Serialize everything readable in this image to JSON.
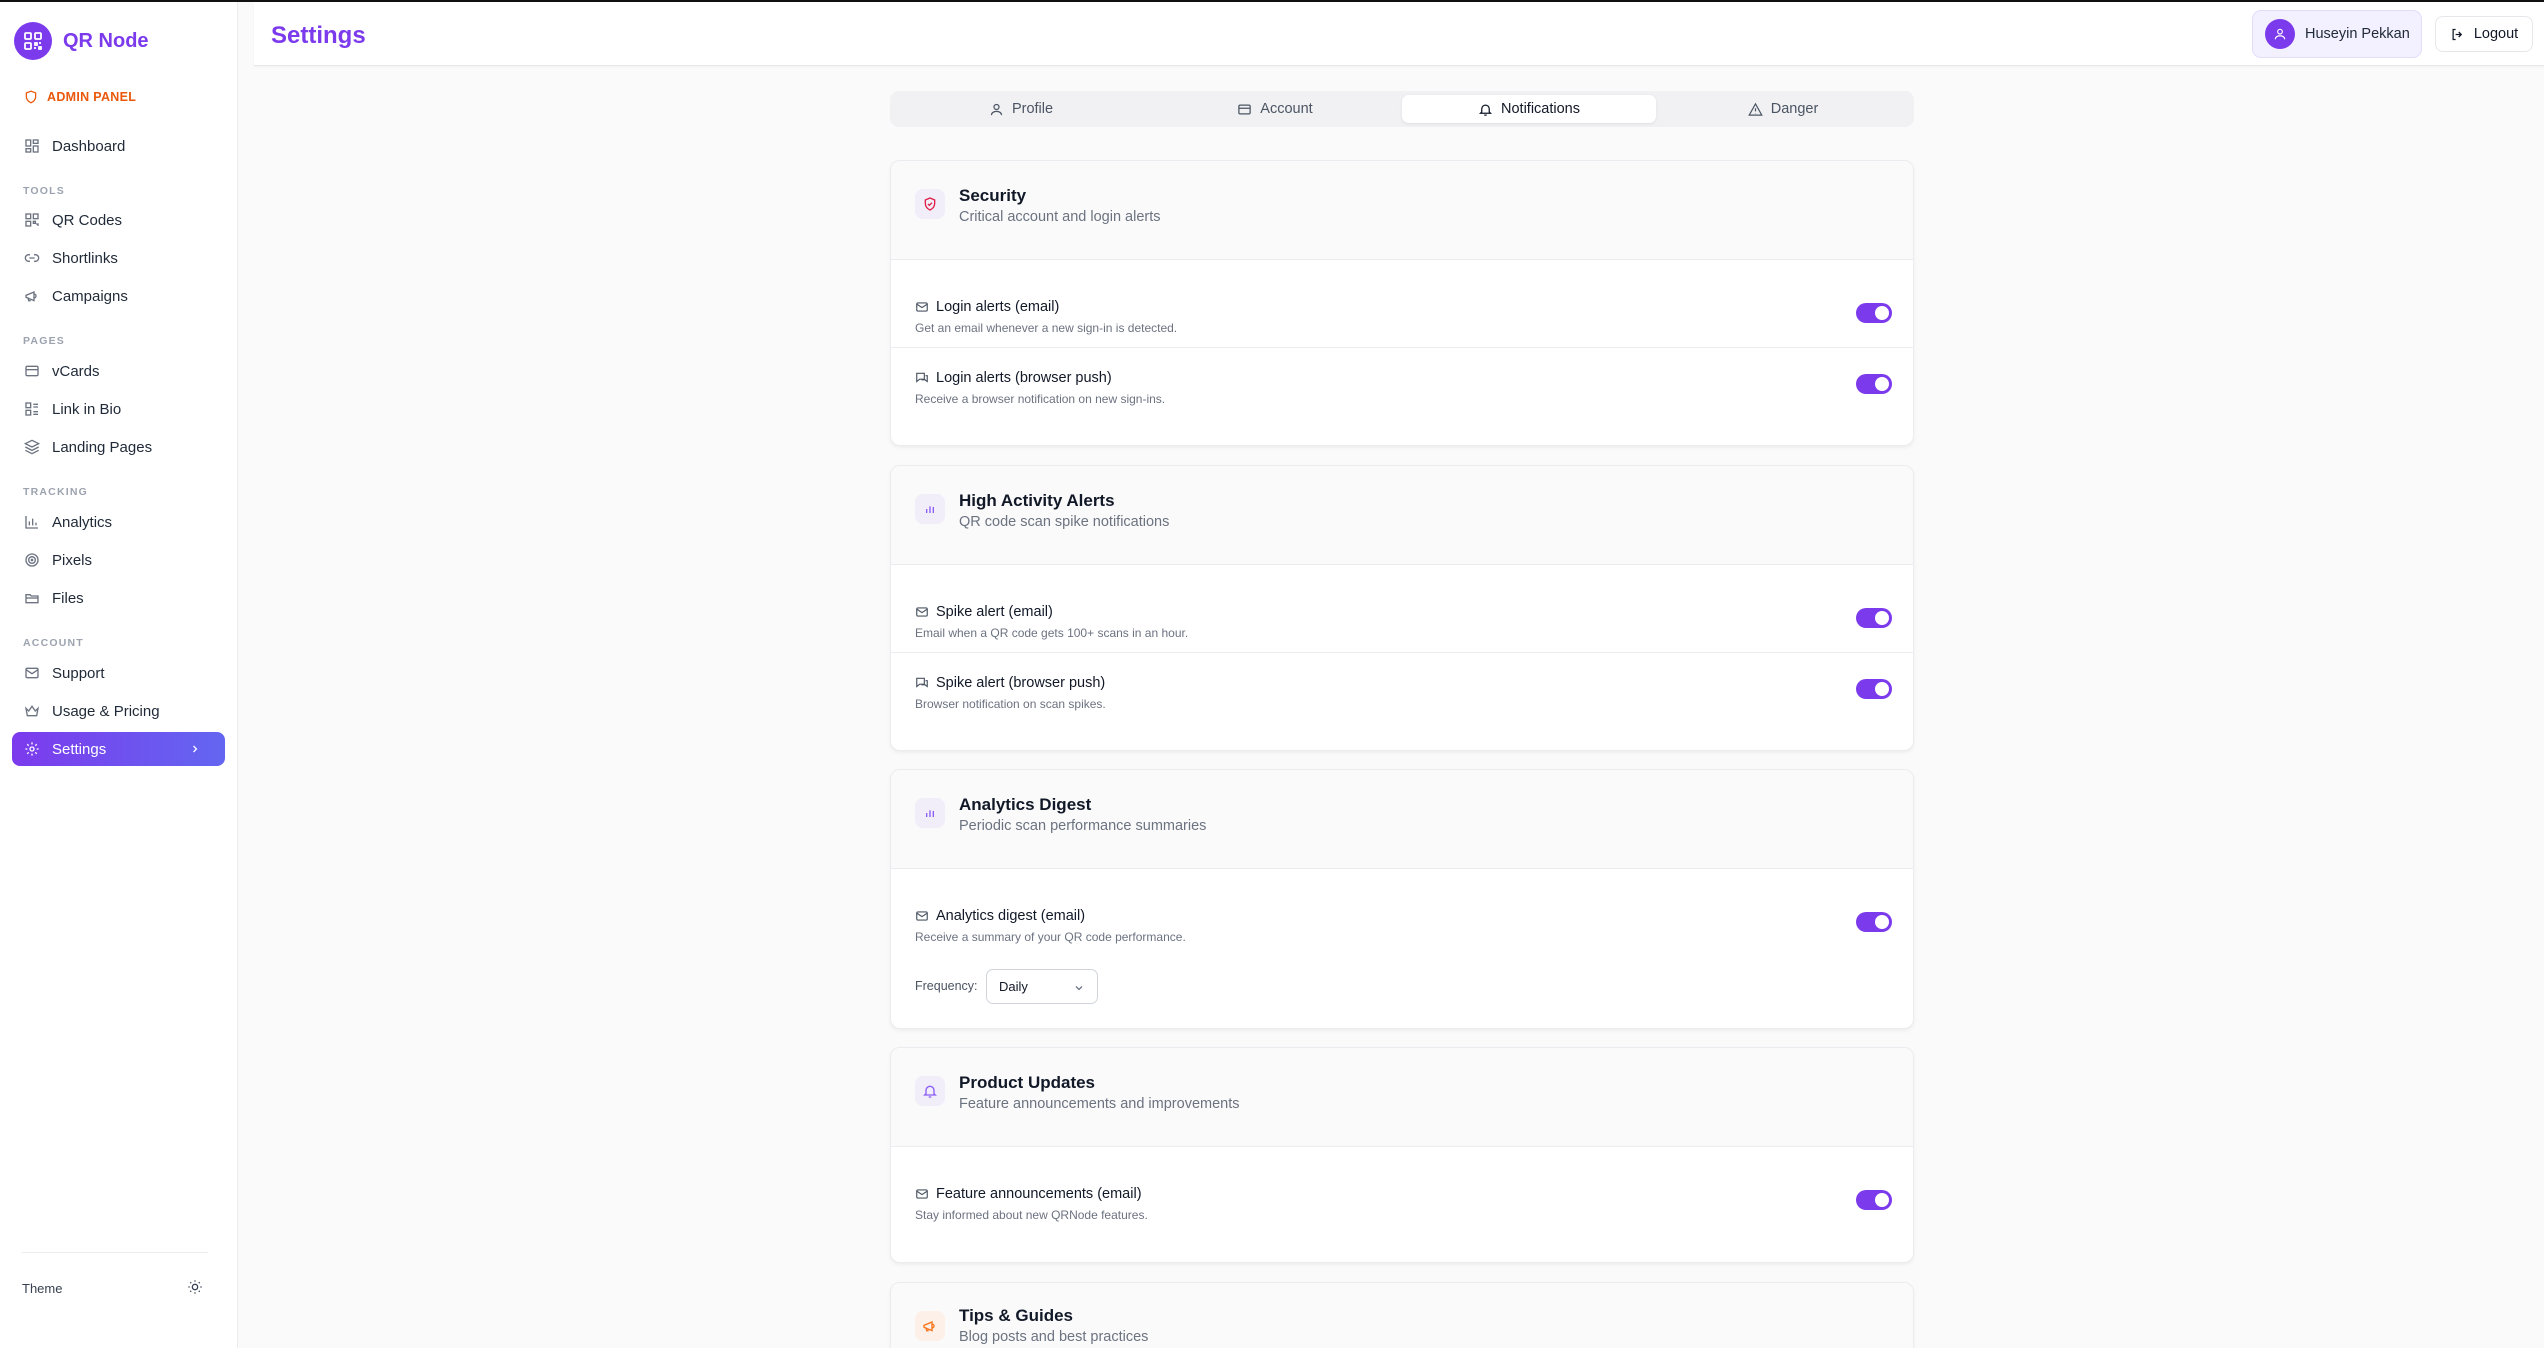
{
  "brand": {
    "name": "QR Node"
  },
  "sidebar": {
    "admin_label": "ADMIN PANEL",
    "dashboard": "Dashboard",
    "sections": [
      {
        "label": "TOOLS",
        "items": [
          {
            "label": "QR Codes",
            "icon": "qr-icon"
          },
          {
            "label": "Shortlinks",
            "icon": "link-icon"
          },
          {
            "label": "Campaigns",
            "icon": "megaphone-icon"
          }
        ]
      },
      {
        "label": "PAGES",
        "items": [
          {
            "label": "vCards",
            "icon": "card-icon"
          },
          {
            "label": "Link in Bio",
            "icon": "list-icon"
          },
          {
            "label": "Landing Pages",
            "icon": "layers-icon"
          }
        ]
      },
      {
        "label": "TRACKING",
        "items": [
          {
            "label": "Analytics",
            "icon": "chart-icon"
          },
          {
            "label": "Pixels",
            "icon": "target-icon"
          },
          {
            "label": "Files",
            "icon": "folder-icon"
          }
        ]
      },
      {
        "label": "ACCOUNT",
        "items": [
          {
            "label": "Support",
            "icon": "mail-icon"
          },
          {
            "label": "Usage & Pricing",
            "icon": "crown-icon"
          },
          {
            "label": "Settings",
            "icon": "gear-icon",
            "active": true
          }
        ]
      }
    ],
    "theme_label": "Theme"
  },
  "header": {
    "title": "Settings",
    "user_name": "Huseyin Pekkan",
    "logout_label": "Logout"
  },
  "tabs": [
    {
      "label": "Profile",
      "icon": "user-icon"
    },
    {
      "label": "Account",
      "icon": "card-icon"
    },
    {
      "label": "Notifications",
      "icon": "bell-icon",
      "active": true
    },
    {
      "label": "Danger",
      "icon": "warning-icon"
    }
  ],
  "cards": {
    "security": {
      "title": "Security",
      "subtitle": "Critical account and login alerts",
      "rows": [
        {
          "title": "Login alerts (email)",
          "desc": "Get an email whenever a new sign-in is detected.",
          "enabled": true
        },
        {
          "title": "Login alerts (browser push)",
          "desc": "Receive a browser notification on new sign-ins.",
          "enabled": true
        }
      ]
    },
    "activity": {
      "title": "High Activity Alerts",
      "subtitle": "QR code scan spike notifications",
      "rows": [
        {
          "title": "Spike alert (email)",
          "desc": "Email when a QR code gets 100+ scans in an hour.",
          "enabled": true
        },
        {
          "title": "Spike alert (browser push)",
          "desc": "Browser notification on scan spikes.",
          "enabled": true
        }
      ]
    },
    "digest": {
      "title": "Analytics Digest",
      "subtitle": "Periodic scan performance summaries",
      "rows": [
        {
          "title": "Analytics digest (email)",
          "desc": "Receive a summary of your QR code performance.",
          "enabled": true
        }
      ],
      "frequency_label": "Frequency:",
      "frequency_value": "Daily"
    },
    "product": {
      "title": "Product Updates",
      "subtitle": "Feature announcements and improvements",
      "rows": [
        {
          "title": "Feature announcements (email)",
          "desc": "Stay informed about new QRNode features.",
          "enabled": true
        }
      ]
    },
    "tips": {
      "title": "Tips & Guides",
      "subtitle": "Blog posts and best practices"
    }
  },
  "colors": {
    "accent": "#7c3aed",
    "admin": "#ea580c",
    "tips_icon": "#f97316"
  }
}
